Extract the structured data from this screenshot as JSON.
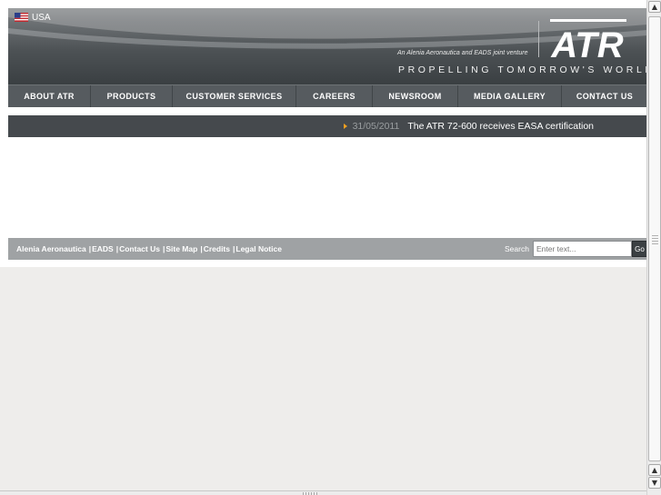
{
  "header": {
    "language": {
      "label": "USA",
      "icon": "us-flag-icon"
    },
    "tagline_small": "An Alenia Aeronautica and EADS joint venture",
    "tagline_big": "PROPELLING TOMORROW'S WORLD",
    "logo_text": "ATR"
  },
  "nav": {
    "items": [
      {
        "label": "ABOUT ATR"
      },
      {
        "label": "PRODUCTS"
      },
      {
        "label": "CUSTOMER SERVICES"
      },
      {
        "label": "CAREERS"
      },
      {
        "label": "NEWSROOM"
      },
      {
        "label": "MEDIA GALLERY"
      },
      {
        "label": "CONTACT US"
      }
    ]
  },
  "news": {
    "date": "31/05/2011",
    "title": "The ATR 72-600 receives EASA certification",
    "bullet_color": "#f0a020"
  },
  "footer": {
    "links": [
      {
        "label": "Alenia Aeronautica"
      },
      {
        "label": "EADS"
      },
      {
        "label": "Contact Us"
      },
      {
        "label": "Site Map"
      },
      {
        "label": "Credits"
      },
      {
        "label": "Legal Notice"
      }
    ],
    "separator": "|",
    "search": {
      "label": "Search",
      "placeholder": "Enter text...",
      "button_label": "Go"
    }
  },
  "colors": {
    "header_dark": "#3a3f42",
    "nav_bg": "#565b5f",
    "news_bg": "#45494d",
    "footer_bg": "#9fa2a4",
    "page_lower_bg": "#eeedeb"
  }
}
